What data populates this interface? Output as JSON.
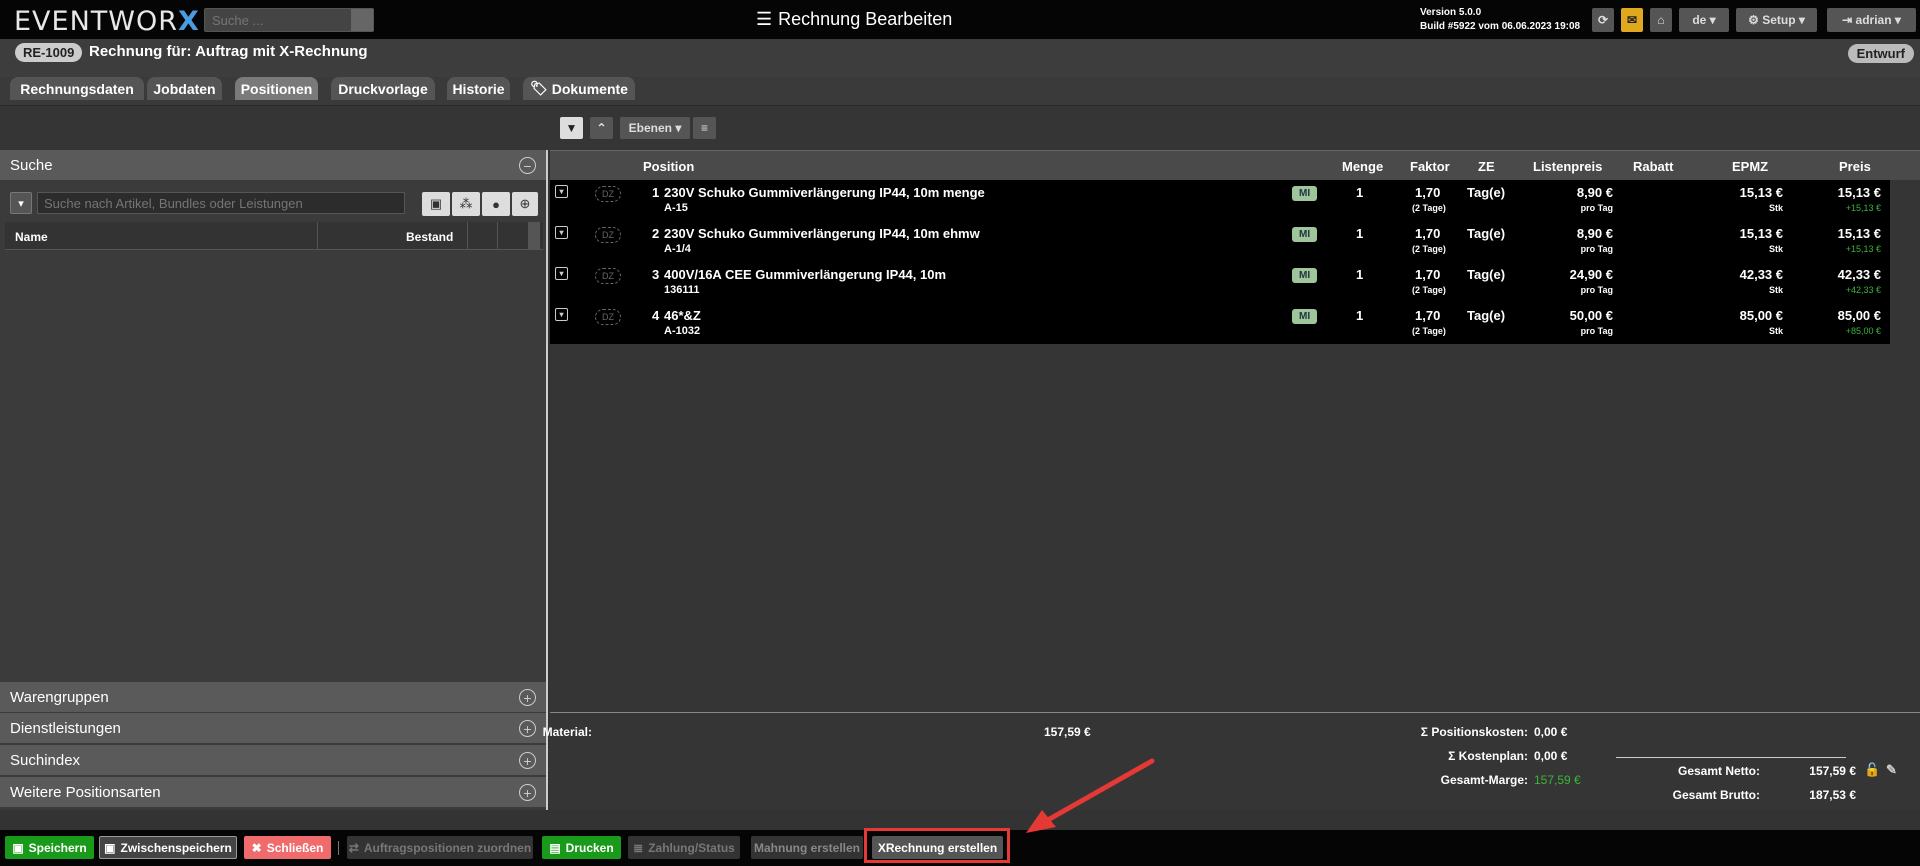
{
  "app": {
    "logo_text": "EVENTWOR",
    "logo_x": "X",
    "search_placeholder": "Suche ...",
    "title": "Rechnung Bearbeiten"
  },
  "version": {
    "line1": "Version 5.0.0",
    "line2": "Build #5922 vom 06.06.2023 19:08"
  },
  "topbar": {
    "lang": "de",
    "setup": "Setup",
    "user": "adrian"
  },
  "invoice": {
    "id": "RE-1009",
    "title": "Rechnung für: Auftrag mit X-Rechnung",
    "status": "Entwurf"
  },
  "tabs": [
    "Rechnungsdaten",
    "Jobdaten",
    "Positionen",
    "Druckvorlage",
    "Historie",
    "Dokumente"
  ],
  "toolbar": {
    "ebenen": "Ebenen"
  },
  "left": {
    "suche": "Suche",
    "search_placeholder": "Suche nach Artikel, Bundles oder Leistungen",
    "col_name": "Name",
    "col_bestand": "Bestand",
    "sections": [
      "Warengruppen",
      "Dienstleistungen",
      "Suchindex",
      "Weitere Positionsarten"
    ]
  },
  "table": {
    "headers": {
      "position": "Position",
      "menge": "Menge",
      "faktor": "Faktor",
      "ze": "ZE",
      "listenpreis": "Listenpreis",
      "rabatt": "Rabatt",
      "epmz": "EPMZ",
      "preis": "Preis"
    },
    "rows": [
      {
        "nr": "1",
        "name": "230V Schuko Gummiverlängerung IP44, 10m menge",
        "code": "A-15",
        "tag": "MI",
        "menge": "1",
        "faktor": "1,70",
        "faktor_sub": "(2 Tage)",
        "ze": "Tag(e)",
        "listenpreis": "8,90 €",
        "lp_sub": "pro Tag",
        "epmz": "15,13 €",
        "epmz_sub": "Stk",
        "preis": "15,13 €",
        "preis_sub": "+15,13 €",
        "dz": "DZ"
      },
      {
        "nr": "2",
        "name": "230V Schuko Gummiverlängerung IP44, 10m ehmw",
        "code": "A-1/4",
        "tag": "MI",
        "menge": "1",
        "faktor": "1,70",
        "faktor_sub": "(2 Tage)",
        "ze": "Tag(e)",
        "listenpreis": "8,90 €",
        "lp_sub": "pro Tag",
        "epmz": "15,13 €",
        "epmz_sub": "Stk",
        "preis": "15,13 €",
        "preis_sub": "+15,13 €",
        "dz": "DZ"
      },
      {
        "nr": "3",
        "name": "400V/16A CEE Gummiverlängerung IP44, 10m",
        "code": "136111",
        "tag": "MI",
        "menge": "1",
        "faktor": "1,70",
        "faktor_sub": "(2 Tage)",
        "ze": "Tag(e)",
        "listenpreis": "24,90 €",
        "lp_sub": "pro Tag",
        "epmz": "42,33 €",
        "epmz_sub": "Stk",
        "preis": "42,33 €",
        "preis_sub": "+42,33 €",
        "dz": "DZ"
      },
      {
        "nr": "4",
        "name": "46*&Z",
        "code": "A-1032",
        "tag": "MI",
        "menge": "1",
        "faktor": "1,70",
        "faktor_sub": "(2 Tage)",
        "ze": "Tag(e)",
        "listenpreis": "50,00 €",
        "lp_sub": "pro Tag",
        "epmz": "85,00 €",
        "epmz_sub": "Stk",
        "preis": "85,00 €",
        "preis_sub": "+85,00 €",
        "dz": "DZ"
      }
    ]
  },
  "summary": {
    "material_label": "Material:",
    "material_value": "157,59 €",
    "poskosten_label": "Σ Positionskosten:",
    "poskosten_value": "0,00 €",
    "kostenplan_label": "Σ Kostenplan:",
    "kostenplan_value": "0,00 €",
    "marge_label": "Gesamt-Marge:",
    "marge_value": "157,59 €",
    "netto_label": "Gesamt Netto:",
    "netto_value": "157,59 €",
    "brutto_label": "Gesamt Brutto:",
    "brutto_value": "187,53 €"
  },
  "bottom": {
    "speichern": "Speichern",
    "zwischenspeichern": "Zwischenspeichern",
    "schliessen": "Schließen",
    "zuordnen": "Auftragspositionen zuordnen",
    "drucken": "Drucken",
    "zahlung": "Zahlung/Status",
    "mahnung": "Mahnung erstellen",
    "xrechnung": "XRechnung erstellen"
  },
  "colors": {
    "accent_blue": "#4a9de0",
    "save_green": "#1a9a1a",
    "close_red": "#f06b6b",
    "highlight_red": "#e53935"
  }
}
